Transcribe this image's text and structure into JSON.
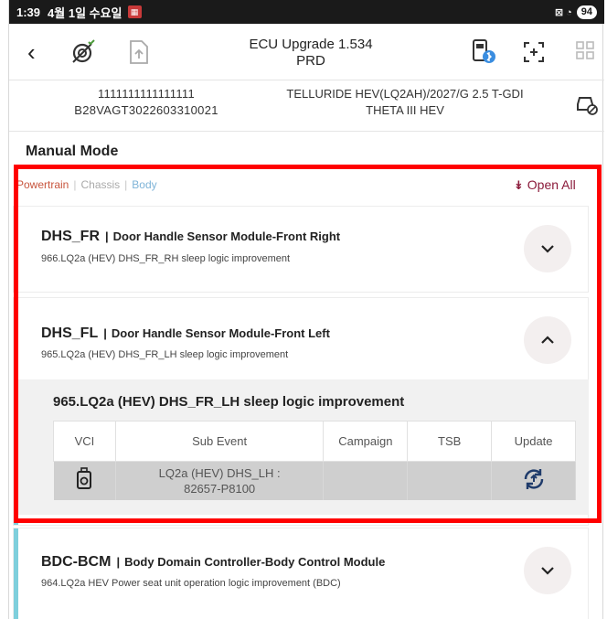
{
  "status": {
    "time": "1:39",
    "date": "4월 1일 수요일",
    "notif": "▦",
    "signal": "⊠ ◔",
    "battery": "94"
  },
  "header": {
    "back_icon": "back-arrow-icon",
    "title_line1": "ECU Upgrade 1.534",
    "title_line2": "PRD"
  },
  "vehicle": {
    "vin_line1": "1111111111111111",
    "vin_line2": "B28VAGT3022603310021",
    "model_line1": "TELLURIDE HEV(LQ2AH)/2027/G 2.5 T-GDI",
    "model_line2": "THETA III HEV"
  },
  "manual_mode": "Manual Mode",
  "filters": {
    "powertrain": "Powertrain",
    "chassis": "Chassis",
    "body": "Body",
    "sep": "|"
  },
  "open_all": "Open All",
  "open_all_icon": "double-chevron-down-icon",
  "cards": [
    {
      "code": "DHS_FR",
      "desc": "Door Handle Sensor Module-Front Right",
      "sub": "966.LQ2a (HEV) DHS_FR_RH sleep logic improvement",
      "state": "collapsed"
    },
    {
      "code": "DHS_FL",
      "desc": "Door Handle Sensor Module-Front Left",
      "sub": "965.LQ2a (HEV) DHS_FR_LH sleep logic improvement",
      "state": "expanded"
    },
    {
      "code": "BDC-BCM",
      "desc": "Body Domain Controller-Body Control Module",
      "sub": "964.LQ2a HEV Power seat unit operation logic improvement (BDC)",
      "state": "collapsed"
    }
  ],
  "expanded": {
    "title": "965.LQ2a (HEV) DHS_FR_LH sleep logic improvement",
    "columns": [
      "VCI",
      "Sub Event",
      "Campaign",
      "TSB",
      "Update"
    ],
    "row": {
      "sub_event_line1": "LQ2a (HEV) DHS_LH :",
      "sub_event_line2": "82657-P8100",
      "campaign": "",
      "tsb": ""
    }
  },
  "pipe": "|",
  "colors": {
    "accent_bar": "#7ecfdc",
    "open_all": "#8b1a3a",
    "highlight": "#ff0000",
    "powertrain": "#c8553d",
    "body": "#7fb4d8"
  }
}
